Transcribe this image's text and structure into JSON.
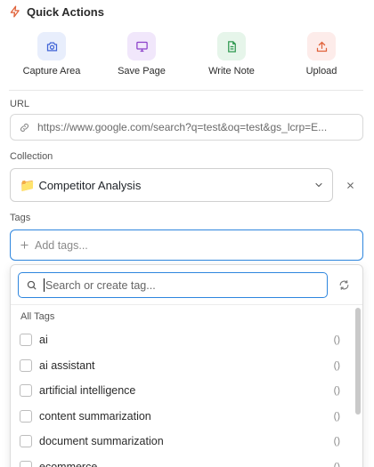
{
  "quick_actions": {
    "title": "Quick Actions",
    "items": [
      {
        "label": "Capture Area",
        "icon": "camera-icon",
        "bg": "#e8eefc",
        "fg": "#3f63d6"
      },
      {
        "label": "Save Page",
        "icon": "monitor-icon",
        "bg": "#f1e7fb",
        "fg": "#8b3fc9"
      },
      {
        "label": "Write Note",
        "icon": "document-icon",
        "bg": "#e6f5ea",
        "fg": "#2f9950"
      },
      {
        "label": "Upload",
        "icon": "upload-icon",
        "bg": "#fdecea",
        "fg": "#e0623a"
      }
    ]
  },
  "url": {
    "label": "URL",
    "value": "https://www.google.com/search?q=test&oq=test&gs_lcrp=E..."
  },
  "collection": {
    "label": "Collection",
    "emoji": "📁",
    "value": "Competitor Analysis"
  },
  "tags": {
    "label": "Tags",
    "placeholder": "Add tags..."
  },
  "tag_dropdown": {
    "search_placeholder": "Search or create tag...",
    "section_label": "All Tags",
    "items": [
      {
        "name": "ai",
        "count": "()"
      },
      {
        "name": "ai assistant",
        "count": "()"
      },
      {
        "name": "artificial intelligence",
        "count": "()"
      },
      {
        "name": "content summarization",
        "count": "()"
      },
      {
        "name": "document summarization",
        "count": "()"
      },
      {
        "name": "ecommerce",
        "count": "()"
      }
    ]
  },
  "colors": {
    "accent": "#2e86de",
    "bolt": "#e0623a"
  }
}
